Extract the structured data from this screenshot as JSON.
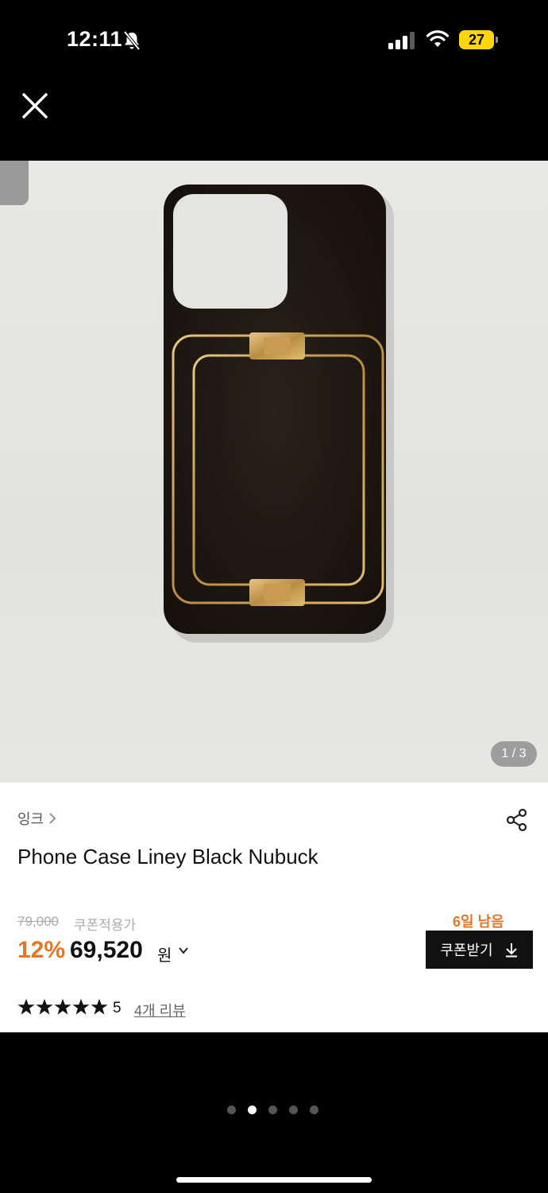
{
  "status_bar": {
    "time": "12:11",
    "battery": "27"
  },
  "image": {
    "counter": "1 / 3"
  },
  "product": {
    "brand": "잉크",
    "title": "Phone Case Liney Black Nubuck",
    "original_price": "79,000",
    "coupon_price_label": "쿠폰적용가",
    "discount_rate": "12%",
    "final_price": "69,520",
    "currency": "원",
    "days_left": "6일 남음",
    "coupon_button_label": "쿠폰받기",
    "rating": "5",
    "review_count_label": "4개 리뷰"
  },
  "pagination": {
    "total": 5,
    "active_index": 1
  },
  "colors": {
    "accent": "#e2772b",
    "button": "#111111"
  }
}
